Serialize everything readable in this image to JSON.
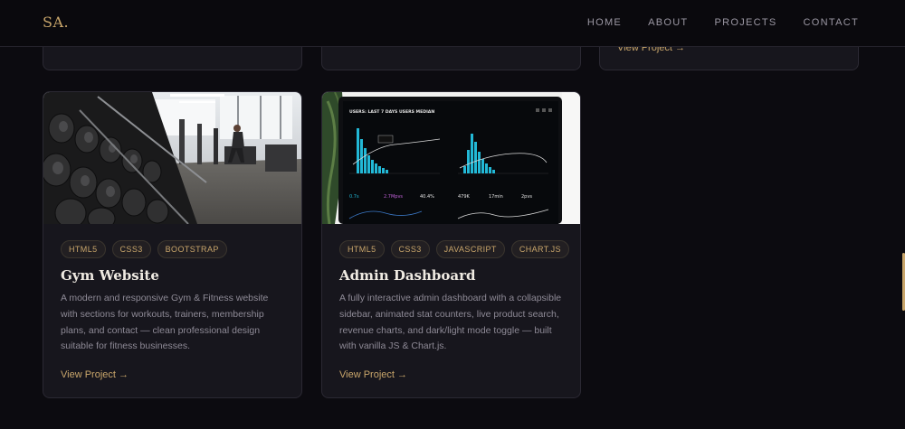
{
  "nav": {
    "logo": "SA.",
    "links": [
      "HOME",
      "ABOUT",
      "PROJECTS",
      "CONTACT"
    ]
  },
  "top_cards": {
    "third_link": "View Project →"
  },
  "projects": [
    {
      "tags": [
        "HTML5",
        "CSS3",
        "BOOTSTRAP"
      ],
      "title": "Gym Website",
      "description": "A modern and responsive Gym & Fitness website with sections for workouts, trainers, membership plans, and contact — clean professional design suitable for fitness businesses.",
      "link": "View Project →"
    },
    {
      "tags": [
        "HTML5",
        "CSS3",
        "JAVASCRIPT",
        "CHART.JS"
      ],
      "title": "Admin Dashboard",
      "description": "A fully interactive admin dashboard with a collapsible sidebar, animated stat counters, live product search, revenue charts, and dark/light mode toggle — built with vanilla JS & Chart.js.",
      "link": "View Project →",
      "thumb_text": {
        "header": "USERS: LAST 7 DAYS USERS MEDIAN",
        "stat1": "0.7s",
        "stat2": "2.7Mpvs",
        "stat3": "40.4%",
        "stat4": "479K",
        "stat5": "17min",
        "stat6": "2pvs"
      }
    }
  ],
  "colors": {
    "accent": "#c9a66b",
    "background": "#0c0b10",
    "card": "#17161d",
    "chart_cyan": "#22b8d6"
  }
}
